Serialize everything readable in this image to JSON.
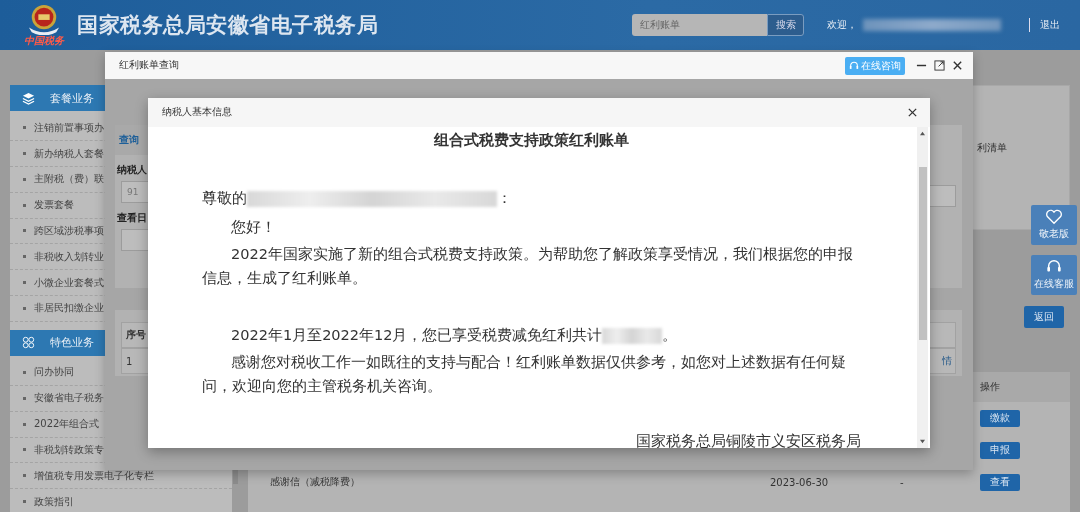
{
  "header": {
    "logo_caption": "中国税务",
    "title": "国家税务总局安徽省电子税务局",
    "search": {
      "value": "红利账单",
      "button": "搜索"
    },
    "welcome": "欢迎，",
    "logout": "退出"
  },
  "sidebar": {
    "groups": [
      {
        "title": "套餐业务",
        "items": [
          "注销前置事项办",
          "新办纳税人套餐",
          "主附税（费）联",
          "发票套餐",
          "跨区域涉税事项",
          "非税收入划转业",
          "小微企业套餐式",
          "非居民扣缴企业"
        ]
      },
      {
        "title": "特色业务",
        "items": [
          "问办协同",
          "安徽省电子税务",
          "2022年组合式",
          "非税划转政策专",
          "增值税专用发票电子化专栏",
          "政策指引"
        ]
      }
    ]
  },
  "main": {
    "panel_title": "利清单",
    "return_button": "返回",
    "table": {
      "columns": [
        "操作"
      ],
      "rows": [
        {
          "cells": [],
          "action": "缴款"
        },
        {
          "cells": [],
          "action": "申报"
        },
        {
          "cells": [
            "感谢信（减税降费）",
            "2023-06-30",
            "-"
          ],
          "action": "查看"
        }
      ]
    }
  },
  "float_buttons": [
    {
      "kind": "elder",
      "label": "敬老版"
    },
    {
      "kind": "service",
      "label": "在线客服"
    }
  ],
  "query_dialog": {
    "title": "红利账单查询",
    "consult_button": "在线咨询",
    "left": {
      "tab": "查询",
      "taxpayer_label": "纳税人",
      "taxpayer_value": "91",
      "date_label": "查看日",
      "table_header": "序号",
      "table_cell": "1"
    },
    "right": {
      "table_cell": "情"
    }
  },
  "notice_dialog": {
    "title": "纳税人基本信息",
    "heading": "组合式税费支持政策红利账单",
    "salutation": "尊敬的",
    "salutation_end": "：",
    "paragraphs": [
      {
        "kind": "plain",
        "text": "您好！",
        "gap_before": false
      },
      {
        "kind": "plain",
        "text": "2022年国家实施了新的组合式税费支持政策。为帮助您了解政策享受情况，我们根据您的申报信息，生成了红利账单。",
        "gap_before": false
      },
      {
        "kind": "redacted_end",
        "text": "2022年1月至2022年12月，您已享受税费减免红利共计",
        "gap_before": true,
        "tail": "。"
      },
      {
        "kind": "plain",
        "text": "感谢您对税收工作一如既往的支持与配合！红利账单数据仅供参考，如您对上述数据有任何疑问，欢迎向您的主管税务机关咨询。",
        "gap_before": false
      }
    ],
    "signature": "国家税务总局铜陵市义安区税务局"
  }
}
